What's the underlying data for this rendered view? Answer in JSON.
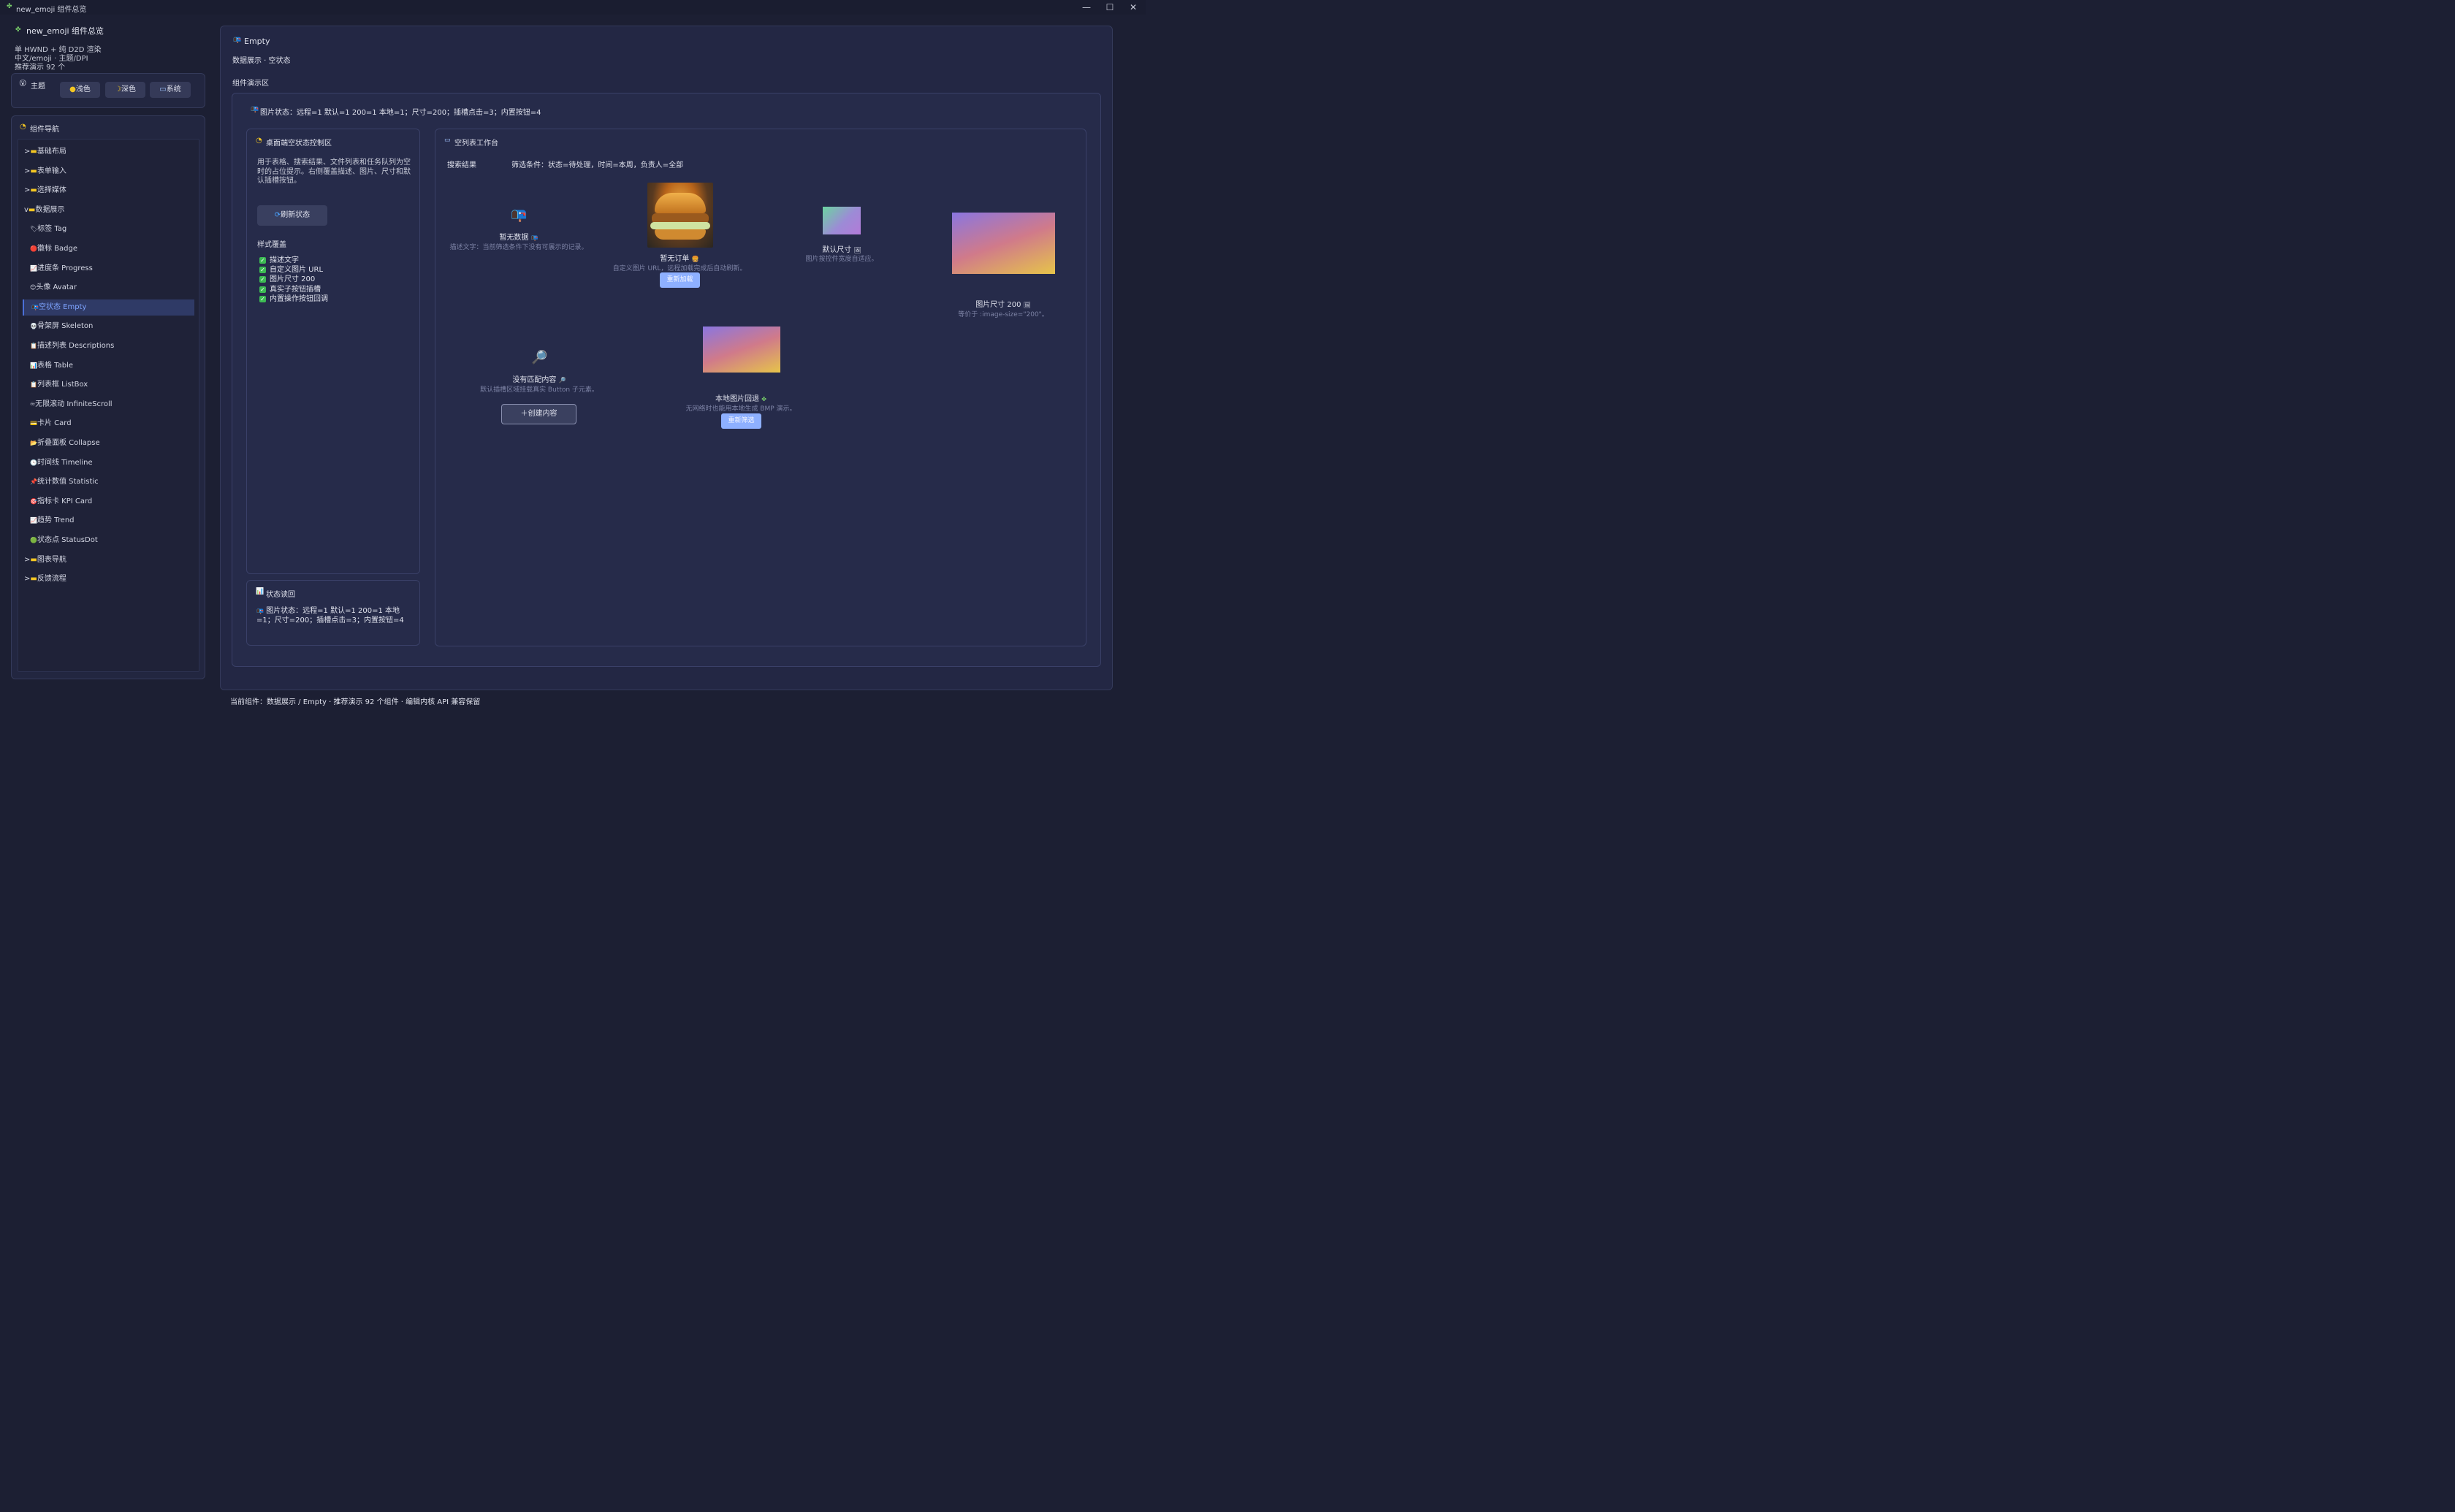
{
  "window": {
    "title": "new_emoji 组件总览",
    "controls": [
      "—",
      "☐",
      "✕"
    ]
  },
  "sidebar": {
    "title": "new_emoji 组件总览",
    "info_lines": [
      "单 HWND + 纯 D2D 渲染",
      "中文/emoji · 主题/DPI",
      "推荐演示 92 个"
    ],
    "theme": {
      "label": "主题",
      "options": [
        "浅色",
        "深色",
        "系统"
      ]
    },
    "nav": {
      "label": "组件导航",
      "groups_before": [
        {
          "label": "基础布局",
          "prefix": ">"
        },
        {
          "label": "表单输入",
          "prefix": ">"
        },
        {
          "label": "选择媒体",
          "prefix": ">"
        },
        {
          "label": "数据展示",
          "prefix": "v"
        }
      ],
      "items": [
        {
          "label": "标签 Tag",
          "icon": "🏷"
        },
        {
          "label": "徽标 Badge",
          "icon": "🔴"
        },
        {
          "label": "进度条 Progress",
          "icon": "📈"
        },
        {
          "label": "头像 Avatar",
          "icon": "😊"
        },
        {
          "label": "空状态 Empty",
          "icon": "📭"
        },
        {
          "label": "骨架屏 Skeleton",
          "icon": "💀"
        },
        {
          "label": "描述列表 Descriptions",
          "icon": "📋"
        },
        {
          "label": "表格 Table",
          "icon": "📊"
        },
        {
          "label": "列表框 ListBox",
          "icon": "📋"
        },
        {
          "label": "无限滚动 InfiniteScroll",
          "icon": "♾"
        },
        {
          "label": "卡片 Card",
          "icon": "💳"
        },
        {
          "label": "折叠面板 Collapse",
          "icon": "📂"
        },
        {
          "label": "时间线 Timeline",
          "icon": "🕓"
        },
        {
          "label": "统计数值 Statistic",
          "icon": "📌"
        },
        {
          "label": "指标卡 KPI Card",
          "icon": "🎯"
        },
        {
          "label": "趋势 Trend",
          "icon": "📈"
        },
        {
          "label": "状态点 StatusDot",
          "icon": "🟢"
        }
      ],
      "active_index": 4,
      "groups_after": [
        {
          "label": "图表导航",
          "prefix": ">"
        },
        {
          "label": "反馈流程",
          "prefix": ">"
        }
      ]
    }
  },
  "main": {
    "title": "Empty",
    "subtitle": "数据展示 · 空状态",
    "demo_label": "组件演示区",
    "status_line": "图片状态：远程=1 默认=1 200=1 本地=1；尺寸=200；插槽点击=3；内置按钮=4",
    "control": {
      "title": "桌面端空状态控制区",
      "description": "用于表格、搜索结果、文件列表和任务队列为空时的占位提示。右侧覆盖描述、图片、尺寸和默认插槽按钮。",
      "refresh_button": "刷新状态",
      "style_label": "样式覆盖",
      "checks": [
        "描述文字",
        "自定义图片 URL",
        "图片尺寸 200",
        "真实子按钮插槽",
        "内置操作按钮回调"
      ]
    },
    "readback": {
      "title": "状态读回",
      "text": "图片状态：远程=1 默认=1 200=1 本地=1；尺寸=200；插槽点击=3；内置按钮=4"
    },
    "workspace": {
      "title": "空列表工作台",
      "search_label": "搜索结果",
      "filter_text": "筛选条件：状态=待处理，时间=本周，负责人=全部",
      "cards": {
        "no_data": {
          "title": "暂无数据",
          "desc": "描述文字：当前筛选条件下没有可展示的记录。"
        },
        "no_order": {
          "title": "暂无订单",
          "desc": "自定义图片 URL，远程加载完成后自动刷新。",
          "button": "重新加载"
        },
        "default_size": {
          "title": "默认尺寸",
          "desc": "图片按控件宽度自适应。"
        },
        "size_200": {
          "title": "图片尺寸 200",
          "desc": "等价于 :image-size=\"200\"。"
        },
        "no_match": {
          "title": "没有匹配内容",
          "desc": "默认插槽区域挂载真实 Button 子元素。",
          "button": "创建内容"
        },
        "local_fallback": {
          "title": "本地图片回退",
          "desc": "无网络时也能用本地生成 BMP 演示。",
          "button": "重新筛选"
        }
      }
    }
  },
  "footer": {
    "text": "当前组件：数据展示 / Empty · 推荐演示 92 个组件 · 编辑内核 API 兼容保留"
  },
  "colors": {
    "background": "#1c1f33",
    "panel": "#222640",
    "accent": "#7ea4ff",
    "button_blue": "#8eb0ff",
    "check_green": "#3cba53"
  }
}
